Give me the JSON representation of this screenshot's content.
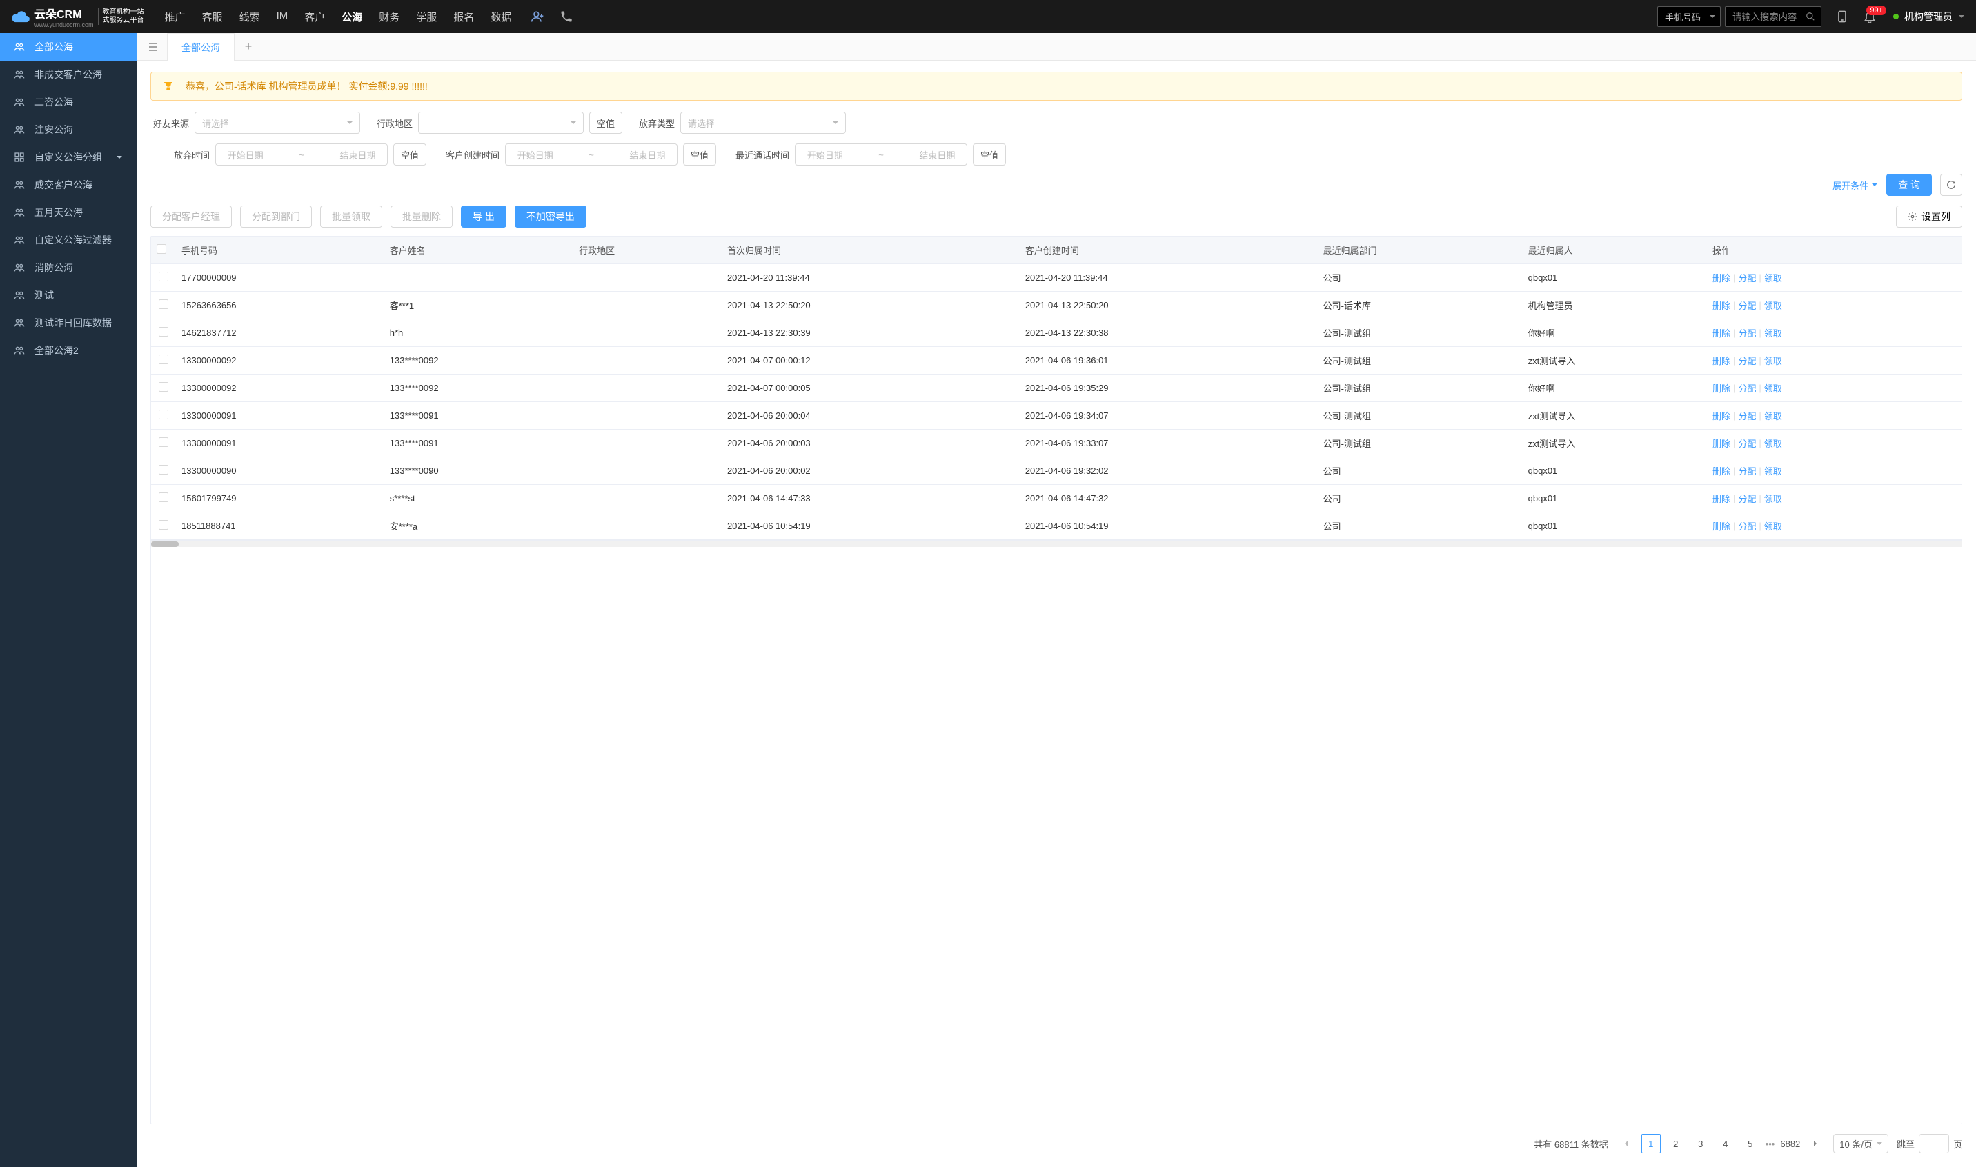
{
  "header": {
    "logo_main": "云朵CRM",
    "logo_sub1": "教育机构一站",
    "logo_sub2": "式服务云平台",
    "logo_url": "www.yunduocrm.com",
    "nav": [
      "推广",
      "客服",
      "线索",
      "IM",
      "客户",
      "公海",
      "财务",
      "学服",
      "报名",
      "数据"
    ],
    "nav_active_index": 5,
    "search_select": "手机号码",
    "search_placeholder": "请输入搜索内容",
    "badge": "99+",
    "user_name": "机构管理员"
  },
  "sidebar": {
    "items": [
      {
        "label": "全部公海",
        "icon": "people"
      },
      {
        "label": "非成交客户公海",
        "icon": "people"
      },
      {
        "label": "二咨公海",
        "icon": "people"
      },
      {
        "label": "注安公海",
        "icon": "people"
      },
      {
        "label": "自定义公海分组",
        "icon": "grid",
        "expandable": true
      },
      {
        "label": "成交客户公海",
        "icon": "people"
      },
      {
        "label": "五月天公海",
        "icon": "people"
      },
      {
        "label": "自定义公海过滤器",
        "icon": "people"
      },
      {
        "label": "消防公海",
        "icon": "people"
      },
      {
        "label": "测试",
        "icon": "people"
      },
      {
        "label": "测试昨日回库数据",
        "icon": "people"
      },
      {
        "label": "全部公海2",
        "icon": "people"
      }
    ],
    "active_index": 0
  },
  "tabs": {
    "active": "全部公海"
  },
  "alert": {
    "text": "恭喜，公司-话术库  机构管理员成单！  实付金额:9.99 !!!!!!"
  },
  "filters": {
    "row1": [
      {
        "label": "好友来源",
        "type": "select",
        "placeholder": "请选择"
      },
      {
        "label": "行政地区",
        "type": "select",
        "placeholder": "",
        "null_btn": "空值"
      },
      {
        "label": "放弃类型",
        "type": "select",
        "placeholder": "请选择"
      }
    ],
    "row2": [
      {
        "label": "放弃时间",
        "type": "daterange",
        "start": "开始日期",
        "end": "结束日期",
        "null_btn": "空值"
      },
      {
        "label": "客户创建时间",
        "type": "daterange",
        "start": "开始日期",
        "end": "结束日期",
        "null_btn": "空值"
      },
      {
        "label": "最近通话时间",
        "type": "daterange",
        "start": "开始日期",
        "end": "结束日期",
        "null_btn": "空值"
      }
    ],
    "expand_label": "展开条件",
    "search_btn": "查 询"
  },
  "toolbar": {
    "assign_mgr": "分配客户经理",
    "assign_dept": "分配到部门",
    "batch_claim": "批量领取",
    "batch_delete": "批量删除",
    "export": "导 出",
    "export_plain": "不加密导出",
    "columns": "设置列"
  },
  "table": {
    "columns": [
      "手机号码",
      "客户姓名",
      "行政地区",
      "首次归属时间",
      "客户创建时间",
      "最近归属部门",
      "最近归属人",
      "操作"
    ],
    "ops": {
      "delete": "删除",
      "assign": "分配",
      "claim": "领取"
    },
    "rows": [
      {
        "phone": "17700000009",
        "name": "",
        "region": "",
        "first_time": "2021-04-20 11:39:44",
        "create_time": "2021-04-20 11:39:44",
        "dept": "公司",
        "owner": "qbqx01"
      },
      {
        "phone": "15263663656",
        "name": "客***1",
        "region": "",
        "first_time": "2021-04-13 22:50:20",
        "create_time": "2021-04-13 22:50:20",
        "dept": "公司-话术库",
        "owner": "机构管理员"
      },
      {
        "phone": "14621837712",
        "name": "h*h",
        "region": "",
        "first_time": "2021-04-13 22:30:39",
        "create_time": "2021-04-13 22:30:38",
        "dept": "公司-测试组",
        "owner": "你好啊"
      },
      {
        "phone": "13300000092",
        "name": "133****0092",
        "region": "",
        "first_time": "2021-04-07 00:00:12",
        "create_time": "2021-04-06 19:36:01",
        "dept": "公司-测试组",
        "owner": "zxt测试导入"
      },
      {
        "phone": "13300000092",
        "name": "133****0092",
        "region": "",
        "first_time": "2021-04-07 00:00:05",
        "create_time": "2021-04-06 19:35:29",
        "dept": "公司-测试组",
        "owner": "你好啊"
      },
      {
        "phone": "13300000091",
        "name": "133****0091",
        "region": "",
        "first_time": "2021-04-06 20:00:04",
        "create_time": "2021-04-06 19:34:07",
        "dept": "公司-测试组",
        "owner": "zxt测试导入"
      },
      {
        "phone": "13300000091",
        "name": "133****0091",
        "region": "",
        "first_time": "2021-04-06 20:00:03",
        "create_time": "2021-04-06 19:33:07",
        "dept": "公司-测试组",
        "owner": "zxt测试导入"
      },
      {
        "phone": "13300000090",
        "name": "133****0090",
        "region": "",
        "first_time": "2021-04-06 20:00:02",
        "create_time": "2021-04-06 19:32:02",
        "dept": "公司",
        "owner": "qbqx01"
      },
      {
        "phone": "15601799749",
        "name": "s****st",
        "region": "",
        "first_time": "2021-04-06 14:47:33",
        "create_time": "2021-04-06 14:47:32",
        "dept": "公司",
        "owner": "qbqx01"
      },
      {
        "phone": "18511888741",
        "name": "安****a",
        "region": "",
        "first_time": "2021-04-06 10:54:19",
        "create_time": "2021-04-06 10:54:19",
        "dept": "公司",
        "owner": "qbqx01"
      }
    ]
  },
  "pagination": {
    "total_prefix": "共有",
    "total": "68811",
    "total_suffix": "条数据",
    "pages": [
      "1",
      "2",
      "3",
      "4",
      "5"
    ],
    "last_page": "6882",
    "page_size": "10 条/页",
    "jump_prefix": "跳至",
    "jump_suffix": "页"
  }
}
